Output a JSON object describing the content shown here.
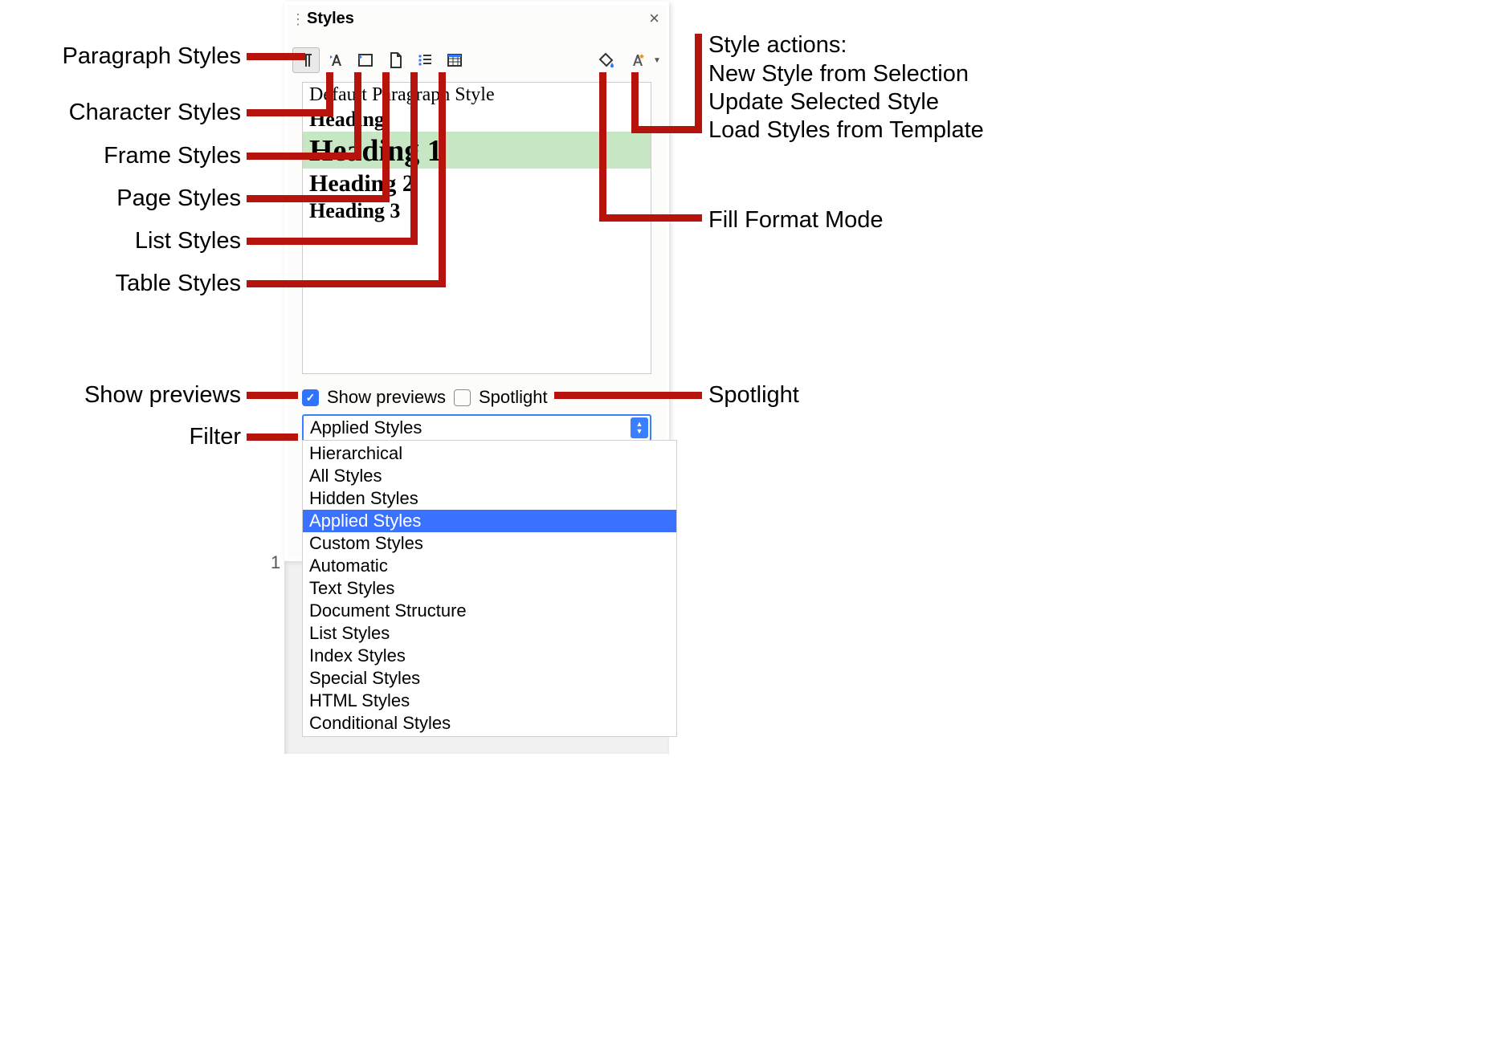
{
  "callouts": {
    "left": {
      "paragraph": "Paragraph Styles",
      "character": "Character Styles",
      "frame": "Frame Styles",
      "page": "Page Styles",
      "list": "List Styles",
      "table": "Table Styles",
      "previews": "Show previews",
      "filter": "Filter"
    },
    "right": {
      "actions_title": "Style actions:",
      "actions_l1": "New Style from Selection",
      "actions_l2": "Update Selected Style",
      "actions_l3": "Load Styles from Template",
      "fill_mode": "Fill Format Mode",
      "spotlight": "Spotlight"
    }
  },
  "panel": {
    "title": "Styles",
    "toolbar": {
      "paragraph_active": true,
      "icons": [
        "paragraph",
        "character",
        "frame",
        "page",
        "list",
        "table"
      ],
      "right_icons": [
        "fill-format",
        "style-actions"
      ]
    },
    "styles": {
      "default": "Default Paragraph Style",
      "heading": "Heading",
      "h1": "Heading 1",
      "h2": "Heading 2",
      "h3": "Heading 3",
      "highlighted": "h1"
    },
    "options": {
      "show_previews_label": "Show previews",
      "show_previews_checked": true,
      "spotlight_label": "Spotlight",
      "spotlight_checked": false
    },
    "filter": {
      "selected": "Applied Styles",
      "options": [
        "Hierarchical",
        "All Styles",
        "Hidden Styles",
        "Applied Styles",
        "Custom Styles",
        "Automatic",
        "Text Styles",
        "Document Structure",
        "List Styles",
        "Index Styles",
        "Special Styles",
        "HTML Styles",
        "Conditional Styles"
      ]
    }
  },
  "page_number": "1",
  "colors": {
    "callout": "#b5130c",
    "accent": "#3a7fff",
    "highlight": "#c7e6c3"
  }
}
